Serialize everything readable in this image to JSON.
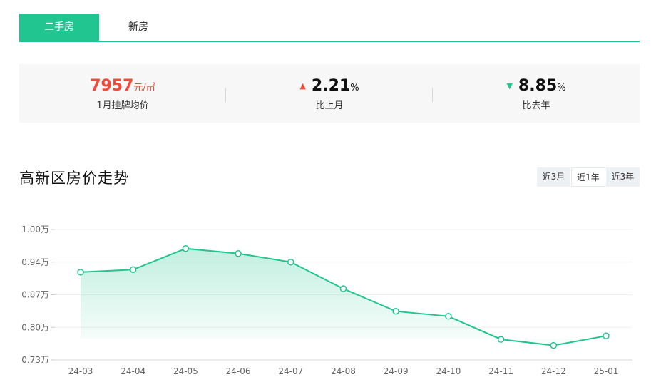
{
  "tabs": {
    "resale": "二手房",
    "new": "新房"
  },
  "stats": {
    "price": {
      "value": "7957",
      "unit": "元/㎡",
      "label": "1月挂牌均价"
    },
    "mom": {
      "direction": "up",
      "arrow": "▲",
      "value": "2.21",
      "unit": "%",
      "label": "比上月"
    },
    "yoy": {
      "direction": "down",
      "arrow": "▼",
      "value": "8.85",
      "unit": "%",
      "label": "比去年"
    }
  },
  "trend": {
    "title": "高新区房价走势",
    "periods": [
      "近3月",
      "近1年",
      "近3年"
    ],
    "active_period": "近1年"
  },
  "colors": {
    "accent": "#21c58f",
    "up": "#f04b3a",
    "down": "#21c58f"
  },
  "chart_data": {
    "type": "area",
    "categories": [
      "24-03",
      "24-04",
      "24-05",
      "24-06",
      "24-07",
      "24-08",
      "24-09",
      "24-10",
      "24-11",
      "24-12",
      "25-01"
    ],
    "values": [
      0.915,
      0.92,
      0.962,
      0.952,
      0.935,
      0.882,
      0.837,
      0.827,
      0.781,
      0.769,
      0.788
    ],
    "yticks": [
      "1.00万",
      "0.94万",
      "0.87万",
      "0.80万",
      "0.73万"
    ],
    "ytick_values": [
      1.0,
      0.935,
      0.87,
      0.805,
      0.74
    ],
    "ylim": [
      0.74,
      1.0
    ],
    "grid": true,
    "title": "",
    "xlabel": "",
    "ylabel": ""
  }
}
